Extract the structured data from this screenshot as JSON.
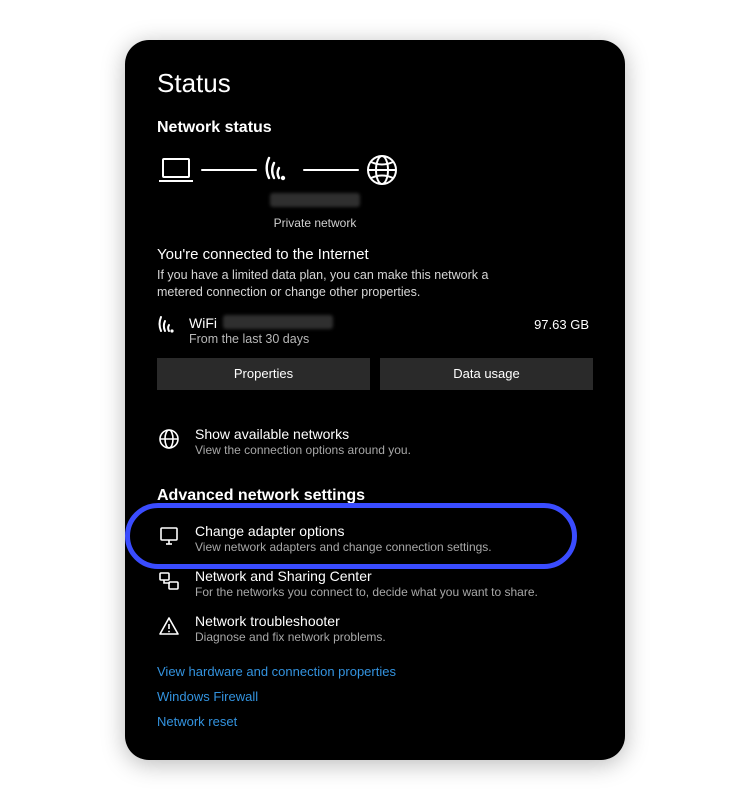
{
  "page_title": "Status",
  "status": {
    "section_title": "Network status",
    "diagram": {
      "laptop_icon": "laptop-icon",
      "wifi_icon": "wifi-signal-icon",
      "globe_icon": "globe-icon",
      "network_name_hidden": true,
      "network_type_label": "Private network"
    },
    "connected": {
      "heading": "You're connected to the Internet",
      "description": "If you have a limited data plan, you can make this network a metered connection or change other properties.",
      "connection_kind": "WiFi",
      "connection_name_hidden": true,
      "period_label": "From the last 30 days",
      "usage_value": "97.63 GB",
      "properties_button": "Properties",
      "data_usage_button": "Data usage"
    },
    "show_networks": {
      "title": "Show available networks",
      "desc": "View the connection options around you."
    }
  },
  "advanced": {
    "section_title": "Advanced network settings",
    "items": [
      {
        "id": "adapter",
        "title": "Change adapter options",
        "desc": "View network adapters and change connection settings.",
        "highlighted": true
      },
      {
        "id": "sharing-center",
        "title": "Network and Sharing Center",
        "desc": "For the networks you connect to, decide what you want to share."
      },
      {
        "id": "troubleshooter",
        "title": "Network troubleshooter",
        "desc": "Diagnose and fix network problems."
      }
    ],
    "links": [
      {
        "id": "hw-props",
        "label": "View hardware and connection properties"
      },
      {
        "id": "firewall",
        "label": "Windows Firewall"
      },
      {
        "id": "reset",
        "label": "Network reset"
      }
    ]
  },
  "colors": {
    "background": "#000000",
    "link": "#3393df",
    "highlight_ring": "#3a4cff",
    "button_bg": "#2a2a2a"
  }
}
